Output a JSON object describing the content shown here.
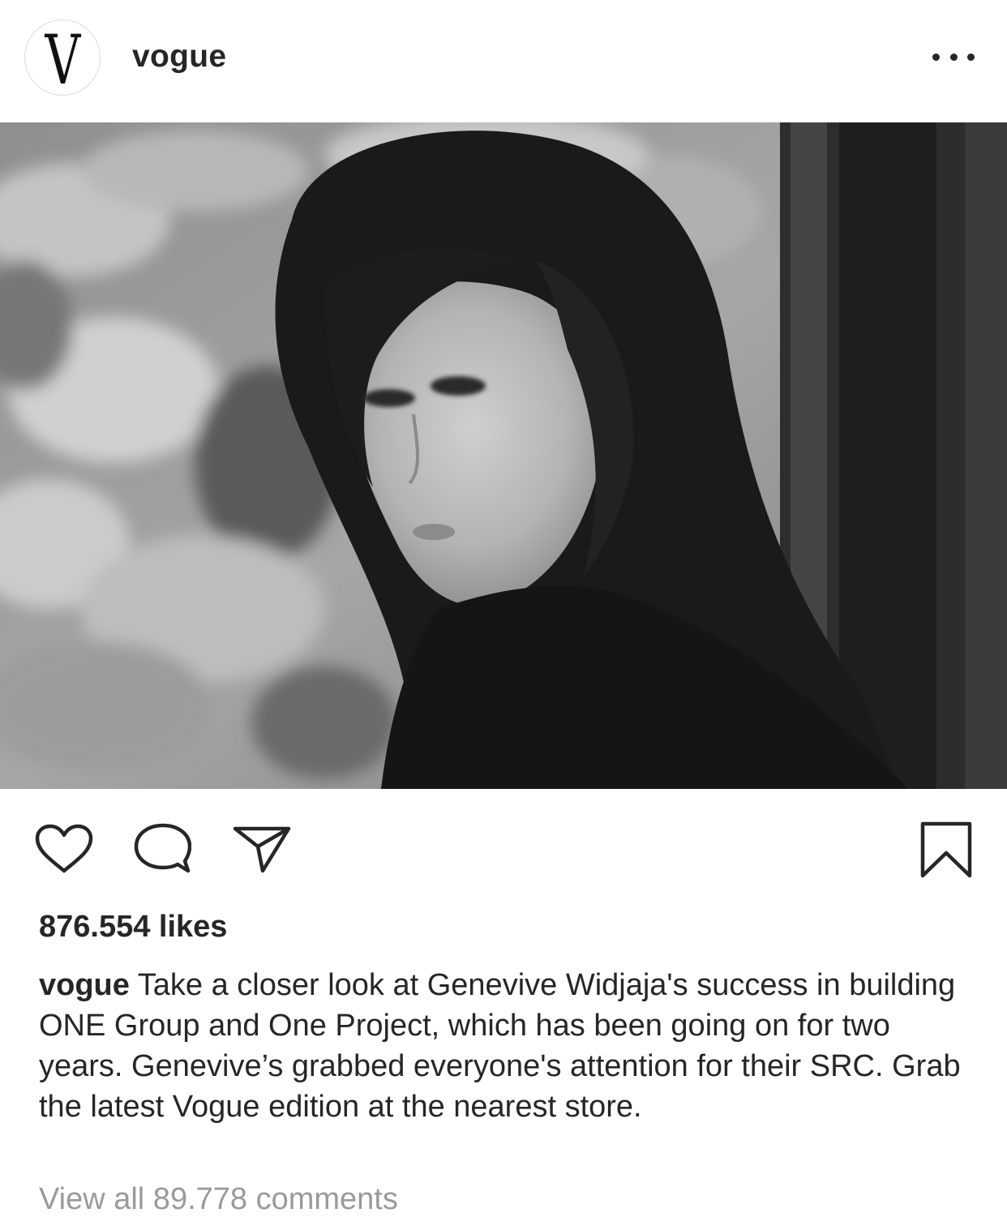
{
  "post": {
    "username": "vogue",
    "avatar_letter": "V",
    "more_icon": "ellipsis-icon",
    "likes_text": "876.554 likes",
    "caption_user": "vogue",
    "caption_text": "Take a closer look at Genevive Widjaja's success in building ONE Group and One Project, which has been going on for two years. Genevive’s grabbed everyone's attention for their SRC. Grab the latest Vogue edition at the nearest store.",
    "view_comments": "View all 89.778 comments"
  },
  "actions": {
    "like_icon": "heart-icon",
    "comment_icon": "comment-icon",
    "share_icon": "send-icon",
    "save_icon": "bookmark-icon"
  },
  "photo": {
    "description_icon": "black-and-white-portrait-photo"
  }
}
